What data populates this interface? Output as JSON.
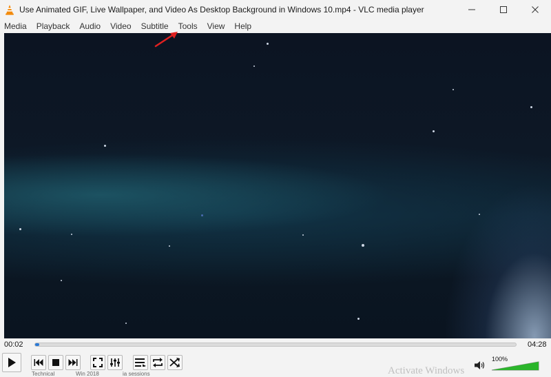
{
  "window": {
    "title": "Use Animated GIF, Live Wallpaper, and Video As Desktop Background in Windows 10.mp4 - VLC media player",
    "app_icon": "vlc-cone-icon",
    "controls": [
      "minimize-icon",
      "maximize-icon",
      "close-icon"
    ]
  },
  "menu": {
    "items": [
      "Media",
      "Playback",
      "Audio",
      "Video",
      "Subtitle",
      "Tools",
      "View",
      "Help"
    ]
  },
  "annotation": {
    "type": "arrow",
    "color": "#e02020",
    "target": "Tools"
  },
  "playback": {
    "elapsed": "00:02",
    "total": "04:28",
    "progress_fraction": 0.008
  },
  "controls": {
    "buttons": [
      "play-icon",
      "previous-icon",
      "stop-icon",
      "next-icon",
      "fullscreen-icon",
      "extended-settings-icon",
      "playlist-icon",
      "loop-icon",
      "shuffle-icon"
    ]
  },
  "volume": {
    "label": "100%",
    "level_fraction": 1.0,
    "icon": "speaker-icon",
    "fill_color": "#2bb52b"
  },
  "overlay": {
    "watermark": "Activate Windows",
    "partial_texts": [
      "Technical",
      "Win 2018",
      "ia sessions"
    ]
  }
}
